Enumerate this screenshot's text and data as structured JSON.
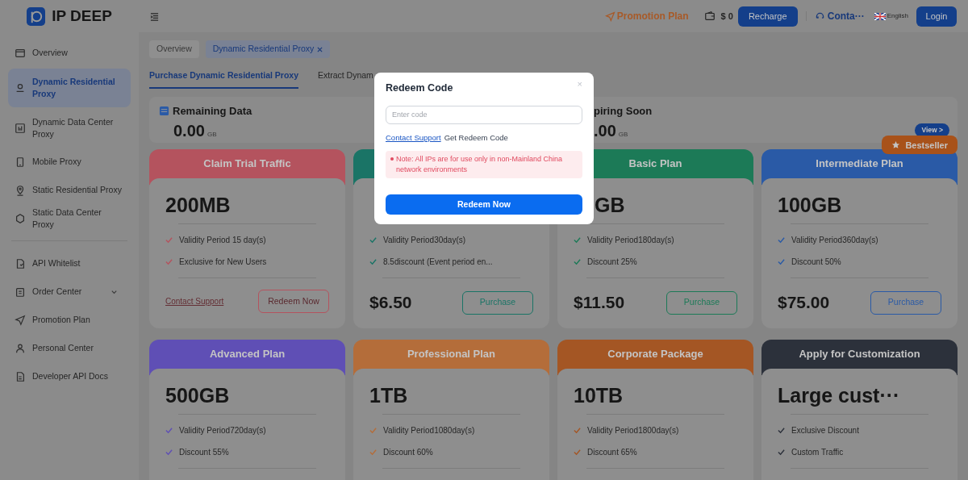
{
  "logo": {
    "text": "IP DEEP"
  },
  "header": {
    "promotion": "Promotion Plan",
    "balance": "$ 0",
    "recharge": "Recharge",
    "contact": "Conta···",
    "language": "English",
    "login": "Login"
  },
  "sidebar": {
    "items": [
      {
        "kind": "overview",
        "label": "Overview",
        "selected": false
      },
      {
        "kind": "residential",
        "label": "Dynamic Residential Proxy",
        "selected": true
      },
      {
        "kind": "datacenter",
        "label": "Dynamic Data Center Proxy",
        "selected": false
      },
      {
        "kind": "mobile",
        "label": "Mobile Proxy",
        "selected": false
      },
      {
        "kind": "pin",
        "label": "Static Residential Proxy",
        "selected": false
      },
      {
        "kind": "hex",
        "label": "Static Data Center Proxy",
        "selected": false
      },
      {
        "kind": "whitelist",
        "label": "API Whitelist",
        "selected": false,
        "group_start": true
      },
      {
        "kind": "order",
        "label": "Order Center",
        "selected": false,
        "expanded": false
      },
      {
        "kind": "send",
        "label": "Promotion Plan",
        "selected": false
      },
      {
        "kind": "person",
        "label": "Personal Center",
        "selected": false
      },
      {
        "kind": "doc",
        "label": "Developer API Docs",
        "selected": false
      }
    ]
  },
  "page_tabs": [
    {
      "label": "Overview",
      "selected": false,
      "closable": false
    },
    {
      "label": "Dynamic Residential Proxy",
      "selected": true,
      "closable": true
    }
  ],
  "sub_tabs": [
    {
      "label": "Purchase Dynamic Residential Proxy",
      "selected": true
    },
    {
      "label": "Extract Dynam",
      "selected": false
    }
  ],
  "stats": [
    {
      "title": "Remaining Data",
      "value": "0.00",
      "unit": "GB"
    },
    {
      "title": "piring Soon",
      "value": ".00",
      "unit": "GB",
      "action": "View >"
    }
  ],
  "cards": [
    {
      "kind": "trial",
      "title": "Claim Trial Traffic",
      "color": "#b4535e",
      "amount": "200MB",
      "features": [
        "Validity Period 15 day(s)",
        "Exclusive for New Users"
      ],
      "link": "Contact Support",
      "button": "Redeem Now"
    },
    {
      "kind": "plan",
      "color": "#1a7466",
      "features": [
        "Validity Period30day(s)",
        "8.5discount (Event period en..."
      ],
      "price": "$6.50",
      "button": "Purchase"
    },
    {
      "kind": "plan",
      "title": "Basic Plan",
      "color": "#1c7a57",
      "amount": "GB",
      "features": [
        "Validity Period180day(s)",
        "Discount 25%"
      ],
      "price": "$11.50",
      "button": "Purchase"
    },
    {
      "kind": "plan",
      "title": "Intermediate Plan",
      "color": "#2a5aa6",
      "amount": "100GB",
      "features": [
        "Validity Period360day(s)",
        "Discount 50%"
      ],
      "price": "$75.00",
      "button": "Purchase",
      "badge": "Bestseller"
    },
    {
      "kind": "plan",
      "title": "Advanced Plan",
      "color": "#5f4fb5",
      "amount": "500GB",
      "features": [
        "Validity Period720day(s)",
        "Discount 55%"
      ]
    },
    {
      "kind": "plan",
      "title": "Professional Plan",
      "color": "#b46d3a",
      "amount": "1TB",
      "features": [
        "Validity Period1080day(s)",
        "Discount 60%"
      ]
    },
    {
      "kind": "plan",
      "title": "Corporate Package",
      "color": "#a45624",
      "amount": "10TB",
      "features": [
        "Validity Period1800day(s)",
        "Discount 65%"
      ]
    },
    {
      "kind": "plan",
      "title": "Apply for Customization",
      "color": "#2c313b",
      "amount": "Large cust···",
      "features": [
        "Exclusive Discount",
        "Custom Traffic"
      ]
    }
  ],
  "dialog": {
    "title": "Redeem Code",
    "close": "×",
    "placeholder": "Enter code",
    "link": "Contact Support",
    "link_hint": "Get Redeem Code",
    "note": "Note: All IPs are for use only in non-Mainland China network environments",
    "button": "Redeem Now"
  }
}
